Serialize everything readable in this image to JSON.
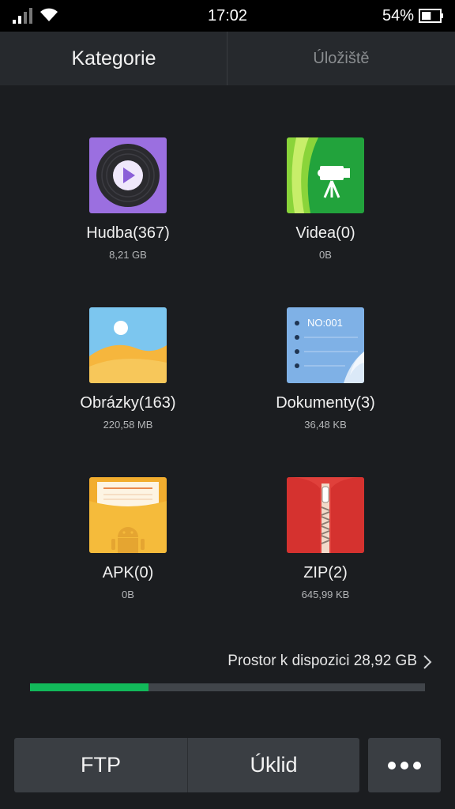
{
  "status_bar": {
    "time": "17:02",
    "battery_percent": "54%",
    "battery_level": 0.54,
    "icons": [
      "signal-icon",
      "wifi-icon",
      "battery-icon"
    ]
  },
  "tabs": [
    {
      "label": "Kategorie",
      "active": true
    },
    {
      "label": "Úložiště",
      "active": false
    }
  ],
  "categories": [
    {
      "label": "Hudba(367)",
      "size": "8,21 GB",
      "icon": "music-icon"
    },
    {
      "label": "Videa(0)",
      "size": "0B",
      "icon": "video-icon"
    },
    {
      "label": "Obrázky(163)",
      "size": "220,58 MB",
      "icon": "image-icon"
    },
    {
      "label": "Dokumenty(3)",
      "size": "36,48 KB",
      "icon": "document-icon",
      "icon_text": "NO:001"
    },
    {
      "label": "APK(0)",
      "size": "0B",
      "icon": "apk-icon"
    },
    {
      "label": "ZIP(2)",
      "size": "645,99 KB",
      "icon": "zip-icon"
    }
  ],
  "storage": {
    "available_text": "Prostor k dispozici 28,92 GB",
    "used_fraction": 0.3
  },
  "buttons": {
    "ftp": "FTP",
    "cleanup": "Úklid",
    "more_icon": "more-icon"
  },
  "colors": {
    "accent": "#12b95a",
    "background": "#1b1d20"
  }
}
